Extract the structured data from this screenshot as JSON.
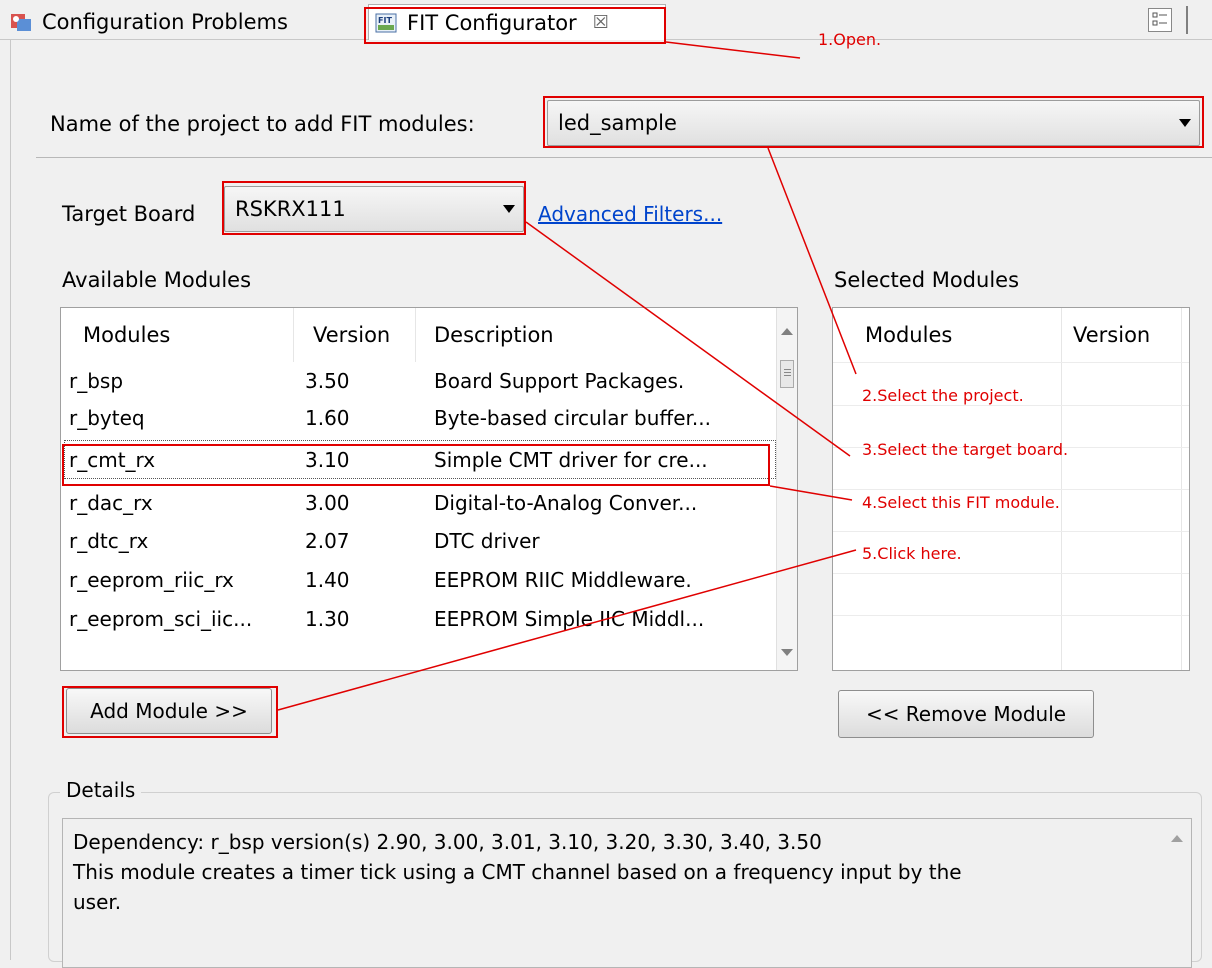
{
  "tabs": {
    "problems": {
      "label": "Configuration Problems",
      "icon": "configuration-problems-icon"
    },
    "fit": {
      "label": "FIT Configurator",
      "icon": "fit-icon",
      "close": "☒"
    }
  },
  "project": {
    "label": "Name of the project to add FIT modules:",
    "value": "led_sample"
  },
  "board": {
    "label": "Target Board",
    "value": "RSKRX111",
    "advanced_link": "Advanced Filters..."
  },
  "available": {
    "title": "Available Modules",
    "columns": [
      "Modules",
      "Version",
      "Description"
    ],
    "rows": [
      {
        "module": "r_bsp",
        "version": "3.50",
        "description": "Board Support Packages."
      },
      {
        "module": "r_byteq",
        "version": "1.60",
        "description": "Byte-based circular buffer..."
      },
      {
        "module": "r_cmt_rx",
        "version": "3.10",
        "description": "Simple CMT driver for cre..."
      },
      {
        "module": "r_dac_rx",
        "version": "3.00",
        "description": "Digital-to-Analog Conver..."
      },
      {
        "module": "r_dtc_rx",
        "version": "2.07",
        "description": "DTC driver"
      },
      {
        "module": "r_eeprom_riic_rx",
        "version": "1.40",
        "description": "EEPROM RIIC Middleware."
      },
      {
        "module": "r_eeprom_sci_iic...",
        "version": "1.30",
        "description": "EEPROM Simple IIC Middl..."
      }
    ]
  },
  "selected": {
    "title": "Selected Modules",
    "columns": [
      "Modules",
      "Version"
    ]
  },
  "buttons": {
    "add": "Add Module >>",
    "remove": "<< Remove Module"
  },
  "details": {
    "title": "Details",
    "line1": "Dependency: r_bsp version(s) 2.90, 3.00, 3.01, 3.10, 3.20, 3.30, 3.40, 3.50",
    "line2": "This module creates a timer tick using a CMT channel based on a frequency input by the",
    "line3": "user."
  },
  "annotations": {
    "a1": "1.Open.",
    "a2": "2.Select the project.",
    "a3": "3.Select the target board.",
    "a4": "4.Select this FIT module.",
    "a5": "5.Click here."
  },
  "colors": {
    "annotation": "#e00000",
    "link": "#0044cc"
  }
}
